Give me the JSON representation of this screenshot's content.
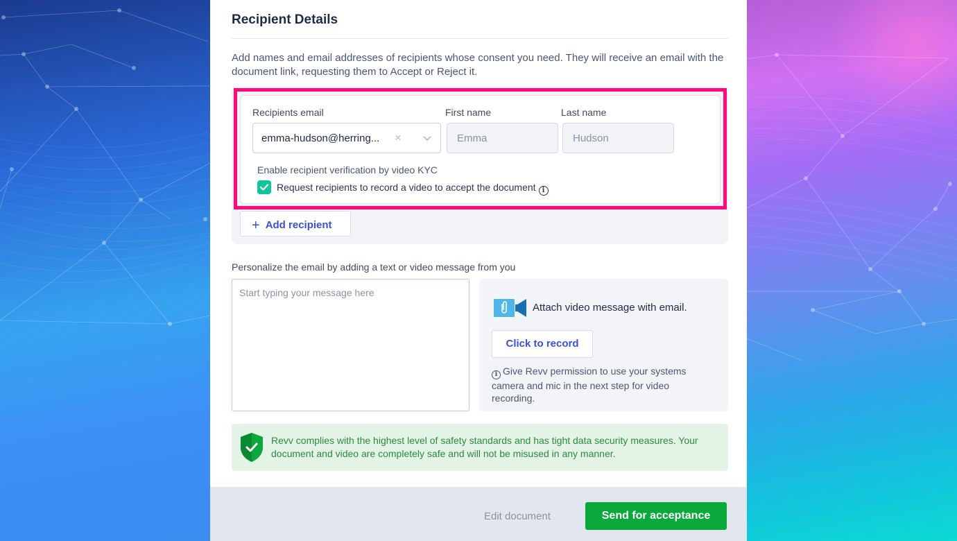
{
  "section": {
    "title": "Recipient Details",
    "description": "Add names and email addresses of recipients whose consent you need. They will receive an email with the document link, requesting them to Accept or Reject it."
  },
  "recipient": {
    "email_label": "Recipients email",
    "email_value": "emma-hudson@herring...",
    "first_name_label": "First name",
    "first_name_value": "Emma",
    "last_name_label": "Last name",
    "last_name_value": "Hudson",
    "kyc_label": "Enable recipient verification by video KYC",
    "kyc_checkbox_label": "Request recipients to record a video to accept the document",
    "kyc_checked": true
  },
  "add_recipient_label": "Add recipient",
  "personalize": {
    "label": "Personalize the email by adding a text or video message from you",
    "message_placeholder": "Start typing your message here",
    "video_title": "Attach video message with email.",
    "record_button": "Click to record",
    "permission_text": "Give Revv permission to use your systems camera and mic in the next step for video recording."
  },
  "security": {
    "text": "Revv complies with the highest level of safety standards and has tight data security measures. Your document and video are completely safe and will not be misused in any manner."
  },
  "footer": {
    "edit_label": "Edit document",
    "send_label": "Send for acceptance"
  },
  "colors": {
    "highlight": "#ff0a7a",
    "primary_link": "#3b4fd8",
    "send_button": "#0ba83b",
    "checkbox": "#12c49a",
    "security_text": "#2b8a3e"
  },
  "icons": {
    "clear": "×",
    "plus": "+",
    "info": "i"
  }
}
